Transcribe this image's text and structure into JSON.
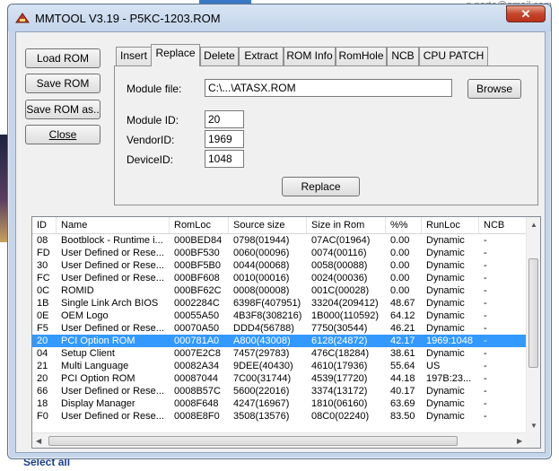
{
  "background": {
    "email_fragment": "p.porto@gmail.com",
    "bottom_link": "Select all"
  },
  "window": {
    "title": "MMTOOL V3.19 - P5KC-1203.ROM",
    "close_glyph": "✕"
  },
  "left_buttons": {
    "load": "Load ROM",
    "save": "Save ROM",
    "save_as": "Save ROM as..",
    "close": "Close"
  },
  "tabs": [
    "Insert",
    "Replace",
    "Delete",
    "Extract",
    "ROM Info",
    "RomHole",
    "NCB",
    "CPU PATCH"
  ],
  "active_tab": "Replace",
  "replace": {
    "module_file_label": "Module file:",
    "module_file_value": "C:\\...\\ATASX.ROM",
    "browse_label": "Browse",
    "module_id_label": "Module ID:",
    "module_id_value": "20",
    "vendor_id_label": "VendorID:",
    "vendor_id_value": "1969",
    "device_id_label": "DeviceID:",
    "device_id_value": "1048",
    "replace_button": "Replace"
  },
  "list": {
    "columns": [
      "ID",
      "Name",
      "RomLoc",
      "Source size",
      "Size in Rom",
      "%%",
      "RunLoc",
      "NCB"
    ],
    "rows": [
      [
        "08",
        "Bootblock - Runtime i...",
        "000BED84",
        "0798(01944)",
        "07AC(01964)",
        "0.00",
        "Dynamic",
        "-"
      ],
      [
        "FD",
        "User Defined or Rese...",
        "000BF530",
        "0060(00096)",
        "0074(00116)",
        "0.00",
        "Dynamic",
        "-"
      ],
      [
        "30",
        "User Defined or Rese...",
        "000BF5B0",
        "0044(00068)",
        "0058(00088)",
        "0.00",
        "Dynamic",
        "-"
      ],
      [
        "FC",
        "User Defined or Rese...",
        "000BF608",
        "0010(00016)",
        "0024(00036)",
        "0.00",
        "Dynamic",
        "-"
      ],
      [
        "0C",
        "ROMID",
        "000BF62C",
        "0008(00008)",
        "001C(00028)",
        "0.00",
        "Dynamic",
        "-"
      ],
      [
        "1B",
        "Single Link Arch BIOS",
        "0002284C",
        "6398F(407951)",
        "33204(209412)",
        "48.67",
        "Dynamic",
        "-"
      ],
      [
        "0E",
        "OEM Logo",
        "00055A50",
        "4B3F8(308216)",
        "1B000(110592)",
        "64.12",
        "Dynamic",
        "-"
      ],
      [
        "F5",
        "User Defined or Rese...",
        "00070A50",
        "DDD4(56788)",
        "7750(30544)",
        "46.21",
        "Dynamic",
        "-"
      ],
      [
        "20",
        "PCI Option ROM",
        "000781A0",
        "A800(43008)",
        "6128(24872)",
        "42.17",
        "1969:1048",
        "-"
      ],
      [
        "04",
        "Setup Client",
        "0007E2C8",
        "7457(29783)",
        "476C(18284)",
        "38.61",
        "Dynamic",
        "-"
      ],
      [
        "21",
        "Multi Language",
        "00082A34",
        "9DEE(40430)",
        "4610(17936)",
        "55.64",
        "US",
        "-"
      ],
      [
        "20",
        "PCI Option ROM",
        "00087044",
        "7C00(31744)",
        "4539(17720)",
        "44.18",
        "197B:23...",
        "-"
      ],
      [
        "66",
        "User Defined or Rese...",
        "0008B57C",
        "5600(22016)",
        "3374(13172)",
        "40.17",
        "Dynamic",
        "-"
      ],
      [
        "18",
        "Display Manager",
        "0008F648",
        "4247(16967)",
        "1810(06160)",
        "63.69",
        "Dynamic",
        "-"
      ],
      [
        "F0",
        "User Defined or Rese...",
        "0008E8F0",
        "3508(13576)",
        "08C0(02240)",
        "83.50",
        "Dynamic",
        "-"
      ]
    ],
    "selected_row": 8
  },
  "colors": {
    "selection": "#3399ff",
    "window_frame": "#c6d6ea",
    "close_button": "#c6452b"
  }
}
